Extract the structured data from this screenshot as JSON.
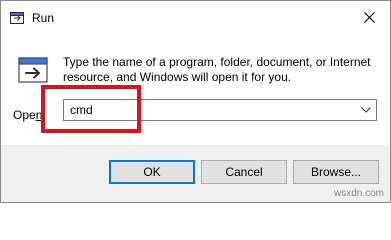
{
  "window": {
    "title": "Run",
    "close_icon": "close-icon",
    "app_icon": "run-app-icon"
  },
  "content": {
    "description": "Type the name of a program, folder, document, or Internet resource, and Windows will open it for you.",
    "open_label_accel": "n",
    "open_label_before": "Ope",
    "open_value": "cmd",
    "dropdown_icon": "chevron-down-icon"
  },
  "buttons": {
    "ok": "OK",
    "cancel": "Cancel",
    "browse": "Browse..."
  },
  "annotation": {
    "highlight_color": "#d9141e"
  },
  "watermark": "wsxdn.com",
  "colors": {
    "dialog_bg": "#f0f0f0",
    "content_bg": "#ffffff",
    "ok_border": "#0078d7"
  }
}
